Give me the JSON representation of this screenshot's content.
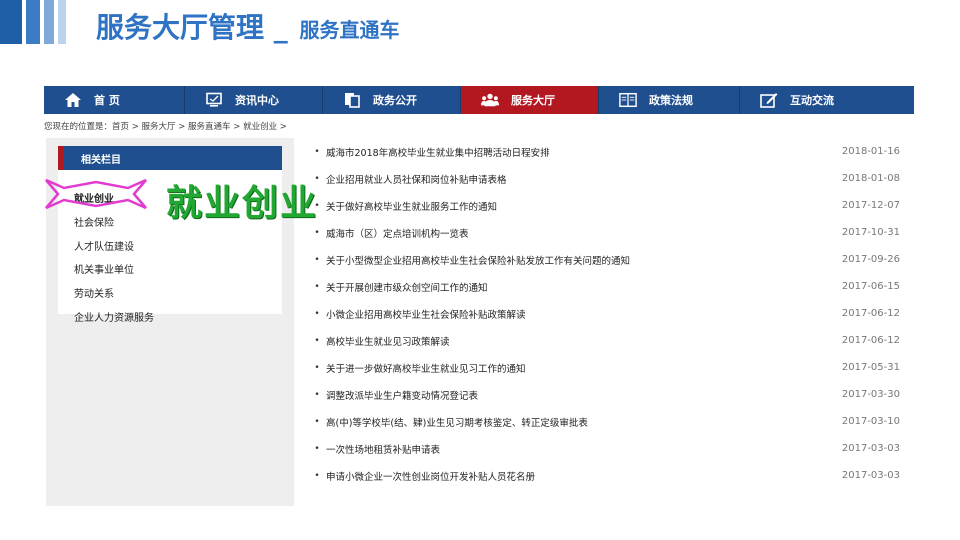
{
  "slide": {
    "title": "服务大厅管理",
    "separator": "_",
    "subtitle": "服务直通车"
  },
  "nav": {
    "items": [
      {
        "label": "首 页",
        "icon": "home-icon"
      },
      {
        "label": "资讯中心",
        "icon": "monitor-icon"
      },
      {
        "label": "政务公开",
        "icon": "document-icon"
      },
      {
        "label": "服务大厅",
        "icon": "people-icon"
      },
      {
        "label": "政策法规",
        "icon": "book-icon"
      },
      {
        "label": "互动交流",
        "icon": "edit-icon"
      }
    ],
    "active_index": 3,
    "active_color": "#b3171f",
    "bar_color": "#1f4f8f"
  },
  "breadcrumb": "您现在的位置是：首页 > 服务大厅 > 服务直通车 > 就业创业 >",
  "sidebar": {
    "heading": "相关栏目",
    "items": [
      "就业创业",
      "社会保险",
      "人才队伍建设",
      "机关事业单位",
      "劳动关系",
      "企业人力资源服务"
    ],
    "highlighted_index": 0
  },
  "annotation": "就业创业",
  "news": [
    {
      "title": "威海市2018年高校毕业生就业集中招聘活动日程安排",
      "date": "2018-01-16"
    },
    {
      "title": "企业招用就业人员社保和岗位补贴申请表格",
      "date": "2018-01-08"
    },
    {
      "title": "关于做好高校毕业生就业服务工作的通知",
      "date": "2017-12-07"
    },
    {
      "title": "威海市（区）定点培训机构一览表",
      "date": "2017-10-31"
    },
    {
      "title": "关于小型微型企业招用高校毕业生社会保险补贴发放工作有关问题的通知",
      "date": "2017-09-26"
    },
    {
      "title": "关于开展创建市级众创空间工作的通知",
      "date": "2017-06-15"
    },
    {
      "title": "小微企业招用高校毕业生社会保险补贴政策解读",
      "date": "2017-06-12"
    },
    {
      "title": "高校毕业生就业见习政策解读",
      "date": "2017-06-12"
    },
    {
      "title": "关于进一步做好高校毕业生就业见习工作的通知",
      "date": "2017-05-31"
    },
    {
      "title": "调整改派毕业生户籍变动情况登记表",
      "date": "2017-03-30"
    },
    {
      "title": "高(中)等学校毕(结、肄)业生见习期考核鉴定、转正定级审批表",
      "date": "2017-03-10"
    },
    {
      "title": "一次性场地租赁补贴申请表",
      "date": "2017-03-03"
    },
    {
      "title": "申请小微企业一次性创业岗位开发补贴人员花名册",
      "date": "2017-03-03"
    }
  ]
}
